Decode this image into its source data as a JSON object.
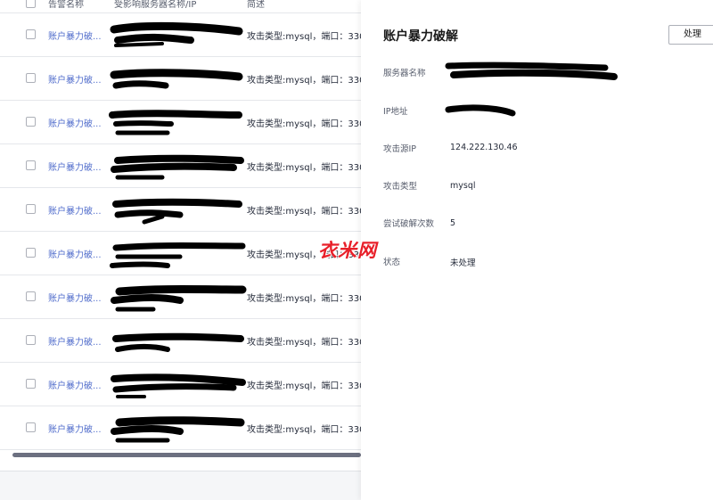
{
  "table": {
    "columns": {
      "alert_name": "告警名称",
      "affected_server": "受影响服务器名称/IP",
      "description": "简述"
    },
    "rows": [
      {
        "name": "账户暴力破...",
        "description": "攻击类型:mysql，端口：330..."
      },
      {
        "name": "账户暴力破...",
        "description": "攻击类型:mysql，端口：330..."
      },
      {
        "name": "账户暴力破...",
        "description": "攻击类型:mysql，端口：330..."
      },
      {
        "name": "账户暴力破...",
        "description": "攻击类型:mysql，端口：330..."
      },
      {
        "name": "账户暴力破...",
        "description": "攻击类型:mysql，端口：330..."
      },
      {
        "name": "账户暴力破...",
        "description": "攻击类型:mysql，端口：330..."
      },
      {
        "name": "账户暴力破...",
        "description": "攻击类型:mysql，端口：330..."
      },
      {
        "name": "账户暴力破...",
        "description": "攻击类型:mysql，端口：330..."
      },
      {
        "name": "账户暴力破...",
        "description": "攻击类型:mysql，端口：330..."
      },
      {
        "name": "账户暴力破...",
        "description": "攻击类型:mysql，端口：330..."
      }
    ]
  },
  "drawer": {
    "title": "账户暴力破解",
    "handle_button": "处理",
    "fields": {
      "server_name_label": "服务器名称",
      "ip_label": "IP地址",
      "source_ip_label": "攻击源IP",
      "source_ip_value": "124.222.130.46",
      "attack_type_label": "攻击类型",
      "attack_type_value": "mysql",
      "attempts_label": "尝试破解次数",
      "attempts_value": "5",
      "status_label": "状态",
      "status_value": "未处理"
    }
  },
  "watermark": "衣米网",
  "colors": {
    "link": "#526ecc",
    "redaction": "#000000",
    "watermark": "#e8202a"
  }
}
